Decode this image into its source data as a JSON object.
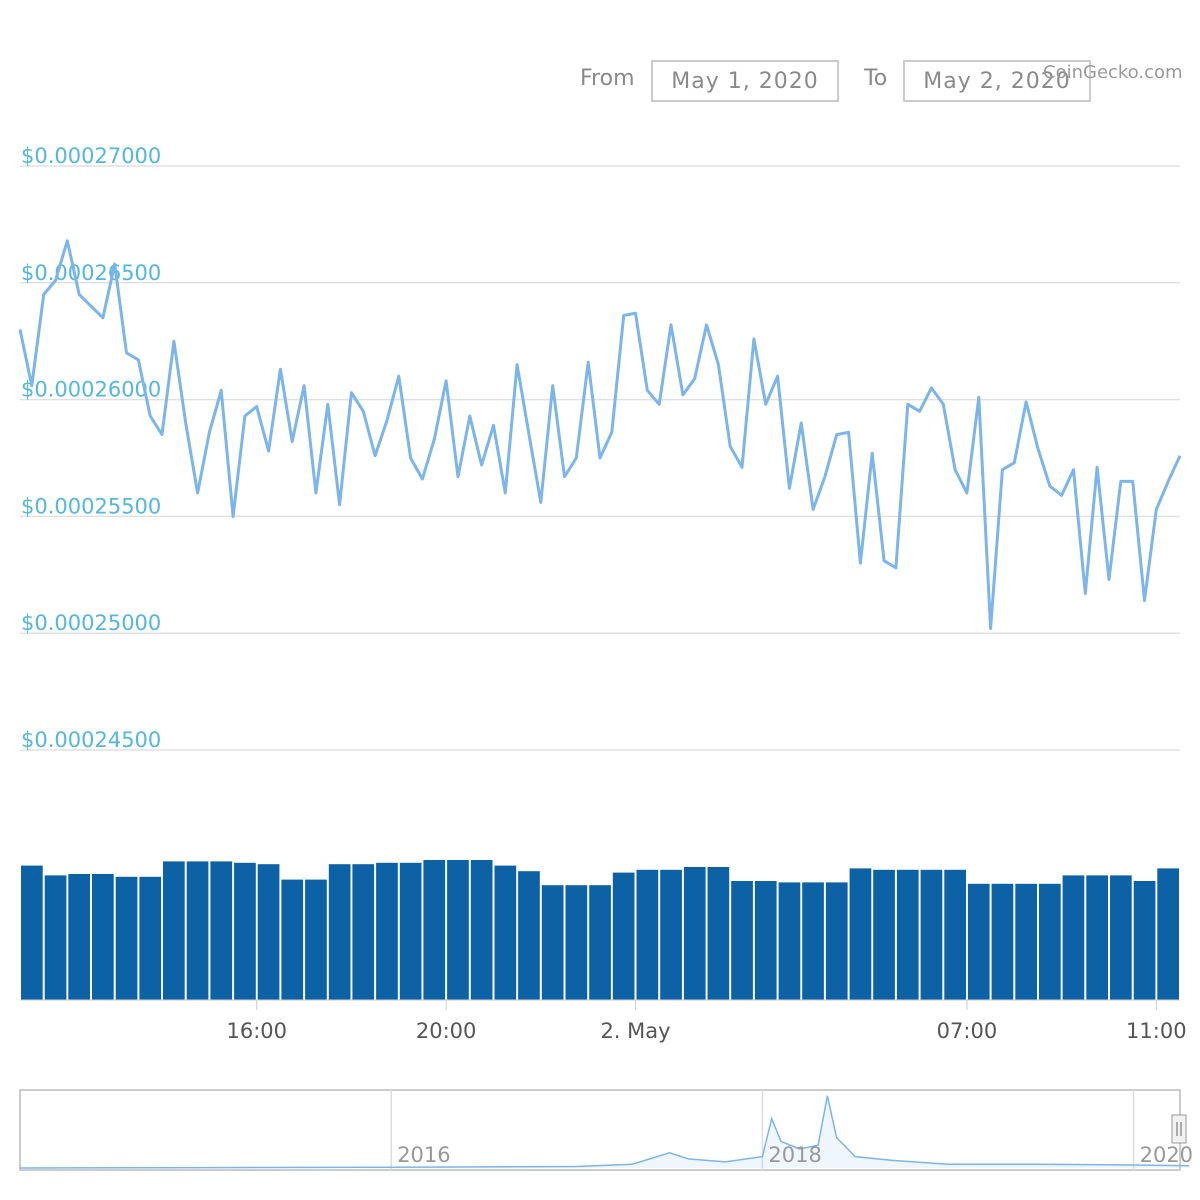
{
  "range_selector": {
    "from_label": "From",
    "from_value": "May 1, 2020",
    "to_label": "To",
    "to_value": "May 2, 2020"
  },
  "credit": "CoinGecko.com",
  "colors": {
    "price_line": "#7cb5ec",
    "volume_bar": "#0c62a5",
    "axis_label": "#53b7e0",
    "grid": "#e0e0e0",
    "navigator_line": "#7cb5ec"
  },
  "chart_data": [
    {
      "type": "line",
      "title": "",
      "xlabel": "",
      "ylabel": "",
      "ylim": [
        0.000245,
        0.00027
      ],
      "y_ticks": [
        0.000245,
        0.00025,
        0.000255,
        0.00026,
        0.000265,
        0.00027
      ],
      "y_tick_labels": [
        "$0.00024500",
        "$0.00025000",
        "$0.00025500",
        "$0.00026000",
        "$0.00026500",
        "$0.00027000"
      ],
      "xlim": [
        "2020-05-01 11:00",
        "2020-05-02 11:30"
      ],
      "x_ticks": [
        "2020-05-01 16:00",
        "2020-05-01 20:00",
        "2020-05-02 00:00",
        "2020-05-02 07:00",
        "2020-05-02 11:00"
      ],
      "x_tick_labels": [
        "16:00",
        "20:00",
        "2. May",
        "07:00",
        "11:00"
      ],
      "grid": true,
      "series": [
        {
          "values": [
            [
              "2020-05-01 11:00",
              0.000263
            ],
            [
              "2020-05-01 11:15",
              0.0002606
            ],
            [
              "2020-05-01 11:30",
              0.0002645
            ],
            [
              "2020-05-01 11:45",
              0.0002651
            ],
            [
              "2020-05-01 12:00",
              0.0002668
            ],
            [
              "2020-05-01 12:15",
              0.0002645
            ],
            [
              "2020-05-01 12:30",
              0.000264
            ],
            [
              "2020-05-01 12:45",
              0.0002635
            ],
            [
              "2020-05-01 13:00",
              0.0002658
            ],
            [
              "2020-05-01 13:15",
              0.000262
            ],
            [
              "2020-05-01 13:30",
              0.0002617
            ],
            [
              "2020-05-01 13:45",
              0.0002593
            ],
            [
              "2020-05-01 14:00",
              0.0002585
            ],
            [
              "2020-05-01 14:15",
              0.0002625
            ],
            [
              "2020-05-01 14:30",
              0.000259
            ],
            [
              "2020-05-01 14:45",
              0.000256
            ],
            [
              "2020-05-01 15:00",
              0.0002586
            ],
            [
              "2020-05-01 15:15",
              0.0002604
            ],
            [
              "2020-05-01 15:30",
              0.000255
            ],
            [
              "2020-05-01 15:45",
              0.0002593
            ],
            [
              "2020-05-01 16:00",
              0.0002597
            ],
            [
              "2020-05-01 16:15",
              0.0002578
            ],
            [
              "2020-05-01 16:30",
              0.0002613
            ],
            [
              "2020-05-01 16:45",
              0.0002582
            ],
            [
              "2020-05-01 17:00",
              0.0002606
            ],
            [
              "2020-05-01 17:15",
              0.000256
            ],
            [
              "2020-05-01 17:30",
              0.0002598
            ],
            [
              "2020-05-01 17:45",
              0.0002555
            ],
            [
              "2020-05-01 18:00",
              0.0002603
            ],
            [
              "2020-05-01 18:15",
              0.0002595
            ],
            [
              "2020-05-01 18:30",
              0.0002576
            ],
            [
              "2020-05-01 18:45",
              0.0002591
            ],
            [
              "2020-05-01 19:00",
              0.000261
            ],
            [
              "2020-05-01 19:15",
              0.0002575
            ],
            [
              "2020-05-01 19:30",
              0.0002566
            ],
            [
              "2020-05-01 19:45",
              0.0002583
            ],
            [
              "2020-05-01 20:00",
              0.0002608
            ],
            [
              "2020-05-01 20:15",
              0.0002567
            ],
            [
              "2020-05-01 20:30",
              0.0002593
            ],
            [
              "2020-05-01 20:45",
              0.0002572
            ],
            [
              "2020-05-01 21:00",
              0.0002589
            ],
            [
              "2020-05-01 21:15",
              0.000256
            ],
            [
              "2020-05-01 21:30",
              0.0002615
            ],
            [
              "2020-05-01 21:45",
              0.0002585
            ],
            [
              "2020-05-01 22:00",
              0.0002556
            ],
            [
              "2020-05-01 22:15",
              0.0002606
            ],
            [
              "2020-05-01 22:30",
              0.0002567
            ],
            [
              "2020-05-01 22:45",
              0.0002575
            ],
            [
              "2020-05-01 23:00",
              0.0002616
            ],
            [
              "2020-05-01 23:15",
              0.0002575
            ],
            [
              "2020-05-01 23:30",
              0.0002586
            ],
            [
              "2020-05-01 23:45",
              0.0002636
            ],
            [
              "2020-05-02 00:00",
              0.0002637
            ],
            [
              "2020-05-02 00:15",
              0.0002604
            ],
            [
              "2020-05-02 00:30",
              0.0002598
            ],
            [
              "2020-05-02 00:45",
              0.0002632
            ],
            [
              "2020-05-02 01:00",
              0.0002602
            ],
            [
              "2020-05-02 01:15",
              0.0002609
            ],
            [
              "2020-05-02 01:30",
              0.0002632
            ],
            [
              "2020-05-02 01:45",
              0.0002615
            ],
            [
              "2020-05-02 02:00",
              0.000258
            ],
            [
              "2020-05-02 02:15",
              0.0002571
            ],
            [
              "2020-05-02 02:30",
              0.0002626
            ],
            [
              "2020-05-02 02:45",
              0.0002598
            ],
            [
              "2020-05-02 03:00",
              0.000261
            ],
            [
              "2020-05-02 03:15",
              0.0002562
            ],
            [
              "2020-05-02 03:30",
              0.000259
            ],
            [
              "2020-05-02 03:45",
              0.0002553
            ],
            [
              "2020-05-02 04:00",
              0.0002567
            ],
            [
              "2020-05-02 04:15",
              0.0002585
            ],
            [
              "2020-05-02 04:30",
              0.0002586
            ],
            [
              "2020-05-02 04:45",
              0.000253
            ],
            [
              "2020-05-02 05:00",
              0.0002577
            ],
            [
              "2020-05-02 05:15",
              0.0002531
            ],
            [
              "2020-05-02 05:30",
              0.0002528
            ],
            [
              "2020-05-02 05:45",
              0.0002598
            ],
            [
              "2020-05-02 06:00",
              0.0002595
            ],
            [
              "2020-05-02 06:15",
              0.0002605
            ],
            [
              "2020-05-02 06:30",
              0.0002598
            ],
            [
              "2020-05-02 06:45",
              0.000257
            ],
            [
              "2020-05-02 07:00",
              0.000256
            ],
            [
              "2020-05-02 07:15",
              0.0002601
            ],
            [
              "2020-05-02 07:30",
              0.0002502
            ],
            [
              "2020-05-02 07:45",
              0.000257
            ],
            [
              "2020-05-02 08:00",
              0.0002573
            ],
            [
              "2020-05-02 08:15",
              0.0002599
            ],
            [
              "2020-05-02 08:30",
              0.0002579
            ],
            [
              "2020-05-02 08:45",
              0.0002563
            ],
            [
              "2020-05-02 09:00",
              0.0002559
            ],
            [
              "2020-05-02 09:15",
              0.000257
            ],
            [
              "2020-05-02 09:30",
              0.0002517
            ],
            [
              "2020-05-02 09:45",
              0.0002571
            ],
            [
              "2020-05-02 10:00",
              0.0002523
            ],
            [
              "2020-05-02 10:15",
              0.0002565
            ],
            [
              "2020-05-02 10:30",
              0.0002565
            ],
            [
              "2020-05-02 10:45",
              0.0002514
            ],
            [
              "2020-05-02 11:00",
              0.0002553
            ],
            [
              "2020-05-02 11:15",
              0.0002565
            ],
            [
              "2020-05-02 11:30",
              0.0002576
            ]
          ]
        }
      ]
    },
    {
      "type": "bar",
      "title": "",
      "xlabel": "",
      "ylabel": "",
      "grid": false,
      "categories": [
        "11:00",
        "11:30",
        "12:00",
        "12:30",
        "13:00",
        "13:30",
        "14:00",
        "14:30",
        "15:00",
        "15:30",
        "16:00",
        "16:30",
        "17:00",
        "17:30",
        "18:00",
        "18:30",
        "19:00",
        "19:30",
        "20:00",
        "20:30",
        "21:00",
        "21:30",
        "22:00",
        "22:30",
        "23:00",
        "23:30",
        "00:00",
        "00:30",
        "01:00",
        "01:30",
        "02:00",
        "02:30",
        "03:00",
        "03:30",
        "04:00",
        "04:30",
        "05:00",
        "05:30",
        "06:00",
        "06:30",
        "07:00",
        "07:30",
        "08:00",
        "08:30",
        "09:00",
        "09:30",
        "10:00",
        "10:30",
        "11:00"
      ],
      "values": [
        0.96,
        0.89,
        0.9,
        0.9,
        0.88,
        0.88,
        0.99,
        0.99,
        0.99,
        0.98,
        0.97,
        0.86,
        0.86,
        0.97,
        0.97,
        0.98,
        0.98,
        1.0,
        1.0,
        1.0,
        0.96,
        0.92,
        0.82,
        0.82,
        0.82,
        0.91,
        0.93,
        0.93,
        0.95,
        0.95,
        0.85,
        0.85,
        0.84,
        0.84,
        0.84,
        0.94,
        0.93,
        0.93,
        0.93,
        0.93,
        0.83,
        0.83,
        0.83,
        0.83,
        0.89,
        0.89,
        0.89,
        0.85,
        0.94
      ],
      "note_scale": "relative"
    },
    {
      "type": "area",
      "title": "",
      "xlabel": "",
      "ylabel": "",
      "grid": true,
      "x_tick_labels": [
        "2016",
        "2018",
        "2020"
      ],
      "x": [
        2014.0,
        2015.0,
        2016.0,
        2017.0,
        2017.3,
        2017.5,
        2017.6,
        2017.8,
        2018.0,
        2018.05,
        2018.1,
        2018.2,
        2018.3,
        2018.35,
        2018.4,
        2018.5,
        2018.7,
        2019.0,
        2019.5,
        2020.0,
        2020.3
      ],
      "values": [
        0.0,
        0.005,
        0.01,
        0.02,
        0.05,
        0.2,
        0.12,
        0.08,
        0.15,
        0.65,
        0.35,
        0.25,
        0.3,
        0.95,
        0.4,
        0.15,
        0.1,
        0.05,
        0.05,
        0.04,
        0.03
      ]
    }
  ]
}
